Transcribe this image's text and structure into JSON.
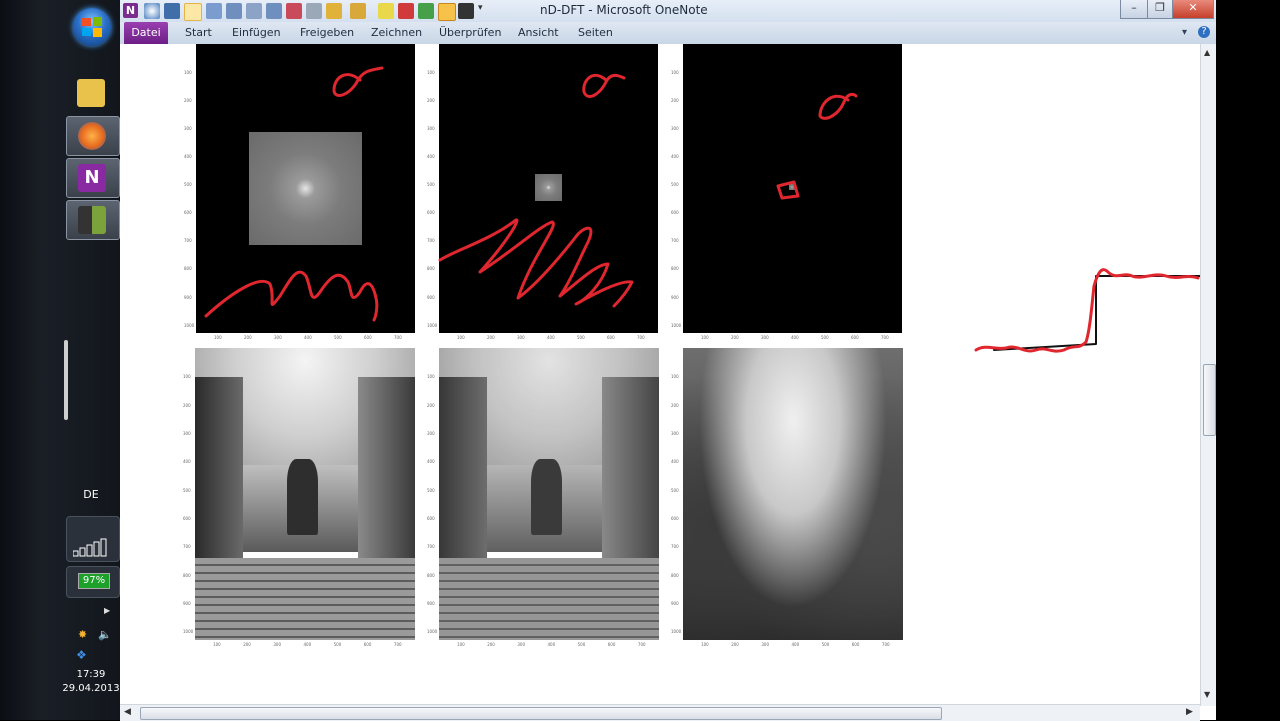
{
  "window": {
    "title": "nD-DFT - Microsoft OneNote",
    "app_letter": "N"
  },
  "ribbon": {
    "tabs": [
      {
        "label": "Datei"
      },
      {
        "label": "Start"
      },
      {
        "label": "Einfügen"
      },
      {
        "label": "Freigeben"
      },
      {
        "label": "Zeichnen"
      },
      {
        "label": "Überprüfen"
      },
      {
        "label": "Ansicht"
      },
      {
        "label": "Seiten"
      }
    ]
  },
  "window_controls": {
    "minimize": "–",
    "restore": "❐",
    "close": "✕",
    "help": "?"
  },
  "taskbar": {
    "language": "DE",
    "battery": "97%",
    "time": "17:39",
    "date": "29.04.2013",
    "apps": [
      {
        "name": "windows-explorer",
        "color": "#e8c24a"
      },
      {
        "name": "firefox",
        "color": "#e66a1e"
      },
      {
        "name": "onenote",
        "color": "#8a2aa3"
      },
      {
        "name": "media-app",
        "color": "#7ca23c"
      }
    ]
  },
  "colors": {
    "ink_red": "#e0262e",
    "ink_black": "#111111",
    "accent_purple": "#7b2c8f"
  },
  "axis_ticks": {
    "y": [
      "100",
      "200",
      "300",
      "400",
      "500",
      "600",
      "700",
      "800",
      "900",
      "1000"
    ],
    "x": [
      "100",
      "200",
      "300",
      "400",
      "500",
      "600",
      "700"
    ]
  }
}
